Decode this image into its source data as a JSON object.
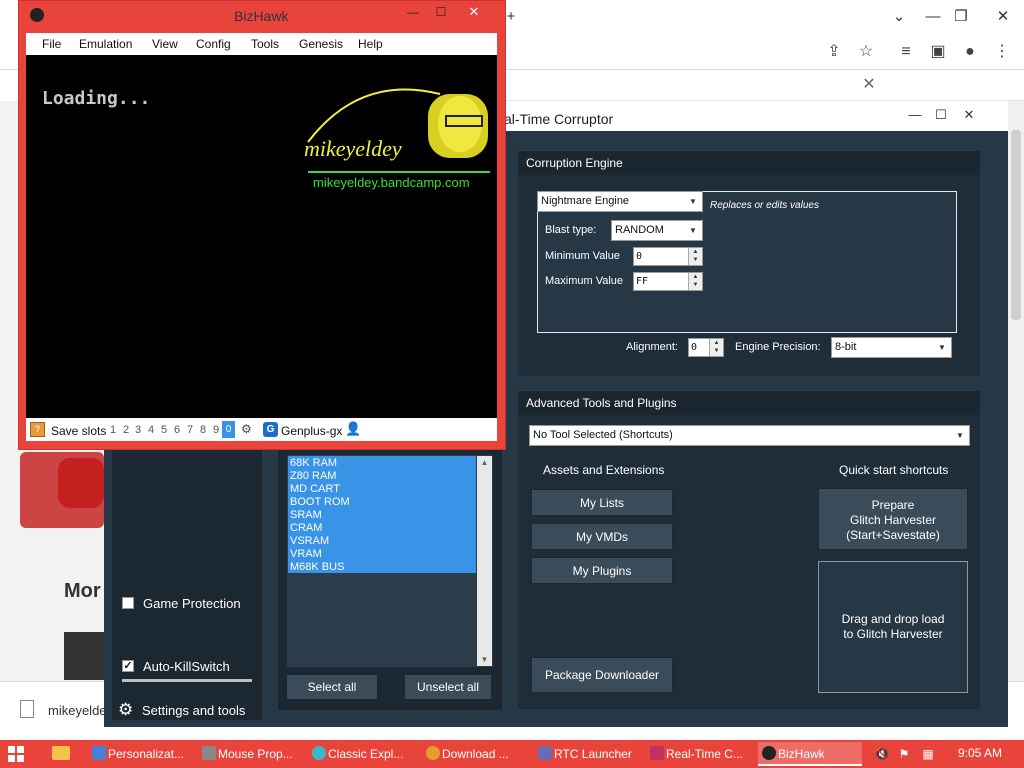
{
  "browser": {
    "tab_new": "+",
    "controls": {
      "dropdown": "⌄",
      "minimize": "—",
      "restore": "❐",
      "close": "✕"
    },
    "toolbar_icons": [
      "share-icon",
      "star-icon",
      "media-icon",
      "sidebar-icon",
      "profile-icon",
      "menu-icon"
    ],
    "info_close": "✕",
    "page_heading_partial": "Mor",
    "download_filename": "mikeyelde"
  },
  "rtc": {
    "title": "al-Time Corruptor",
    "controls": {
      "minimize": "—",
      "maximize": "☐",
      "close": "✕"
    },
    "left": {
      "game_protection_label": "Game Protection",
      "game_protection_checked": false,
      "autokillswitch_label": "Auto-KillSwitch",
      "autokillswitch_checked": true,
      "autokillswitch_mark": "✓",
      "settings_label": "Settings and tools"
    },
    "memory_domains": {
      "items": [
        "68K RAM",
        "Z80 RAM",
        "MD CART",
        "BOOT ROM",
        "SRAM",
        "CRAM",
        "VSRAM",
        "VRAM",
        "M68K BUS"
      ],
      "select_all": "Select all",
      "unselect_all": "Unselect all"
    },
    "corruption_engine": {
      "title": "Corruption Engine",
      "engine": "Nightmare Engine",
      "engine_description": "Replaces or edits values",
      "blast_type_label": "Blast type:",
      "blast_type": "RANDOM",
      "min_label": "Minimum Value",
      "min_value": "0",
      "max_label": "Maximum Value",
      "max_value": "FF",
      "alignment_label": "Alignment:",
      "alignment_value": "0",
      "precision_label": "Engine Precision:",
      "precision_value": "8-bit"
    },
    "advanced_tools": {
      "title": "Advanced Tools and Plugins",
      "tool_selected": "No Tool Selected (Shortcuts)",
      "assets_title": "Assets and Extensions",
      "quick_title": "Quick start shortcuts",
      "my_lists": "My Lists",
      "my_vmds": "My VMDs",
      "my_plugins": "My Plugins",
      "glitch_harvester_line1": "Prepare",
      "glitch_harvester_line2": "Glitch Harvester",
      "glitch_harvester_line3": "(Start+Savestate)",
      "dnd_line1": "Drag and drop load",
      "dnd_line2": "to Glitch Harvester",
      "package_downloader": "Package Downloader"
    }
  },
  "bizhawk": {
    "title": "BizHawk",
    "menu": [
      "File",
      "Emulation",
      "View",
      "Config",
      "Tools",
      "Genesis",
      "Help"
    ],
    "screen_text": "Loading...",
    "logo_name": "mikeyeldey",
    "logo_url": "mikeyeldey.bandcamp.com",
    "save_slots_label": "Save slots",
    "slots": [
      "1",
      "2",
      "3",
      "4",
      "5",
      "6",
      "7",
      "8",
      "9"
    ],
    "active_slot": "0",
    "core": "Genplus-gx"
  },
  "taskbar": {
    "items": [
      {
        "label": "Personalizat...",
        "icon_color": "#4a7fd4"
      },
      {
        "label": "Mouse Prop...",
        "icon_color": "#888888"
      },
      {
        "label": "Classic Expl...",
        "icon_color": "#3fb7c9"
      },
      {
        "label": "Download ...",
        "icon_color": "#e0a02c"
      },
      {
        "label": "RTC Launcher",
        "icon_color": "#6a6ab0"
      },
      {
        "label": "Real-Time C...",
        "icon_color": "#c03060"
      },
      {
        "label": "BizHawk",
        "icon_color": "#222222"
      }
    ],
    "active_item": "BizHawk",
    "clock": "9:05 AM"
  },
  "colors": {
    "bizhawk_frame": "#e8443c",
    "taskbar": "#e8443c",
    "rtc_background": "#263745",
    "selection_blue": "#3994e8",
    "logo_green": "#34e034",
    "logo_yellow": "#f0f040"
  }
}
